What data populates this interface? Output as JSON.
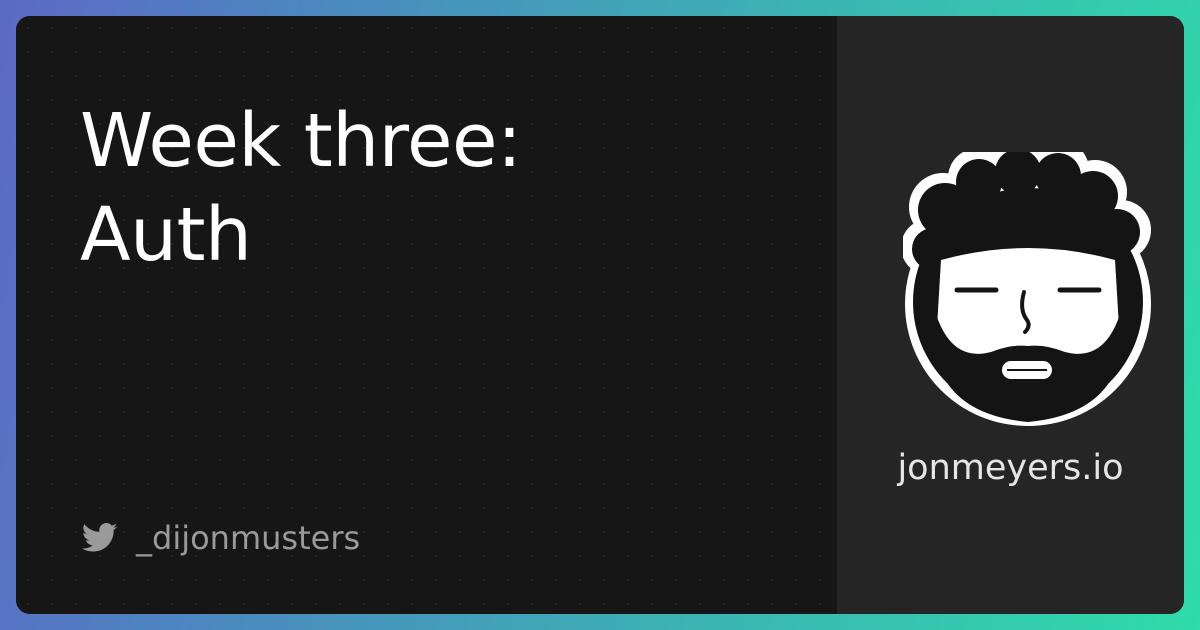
{
  "title": {
    "line1": "Week three:",
    "line2": "Auth"
  },
  "author": {
    "twitter_handle": "_dijonmusters",
    "twitter_icon": "twitter-bird-icon"
  },
  "brand": {
    "site": "jonmeyers.io",
    "avatar": "bearded-face-avatar"
  },
  "colors": {
    "gradient_start": "#5d69c6",
    "gradient_end": "#2fdbaa",
    "card_background": "#161616",
    "side_panel_background": "#252525",
    "title_text": "#ffffff",
    "handle_text": "#9a9a9a"
  }
}
